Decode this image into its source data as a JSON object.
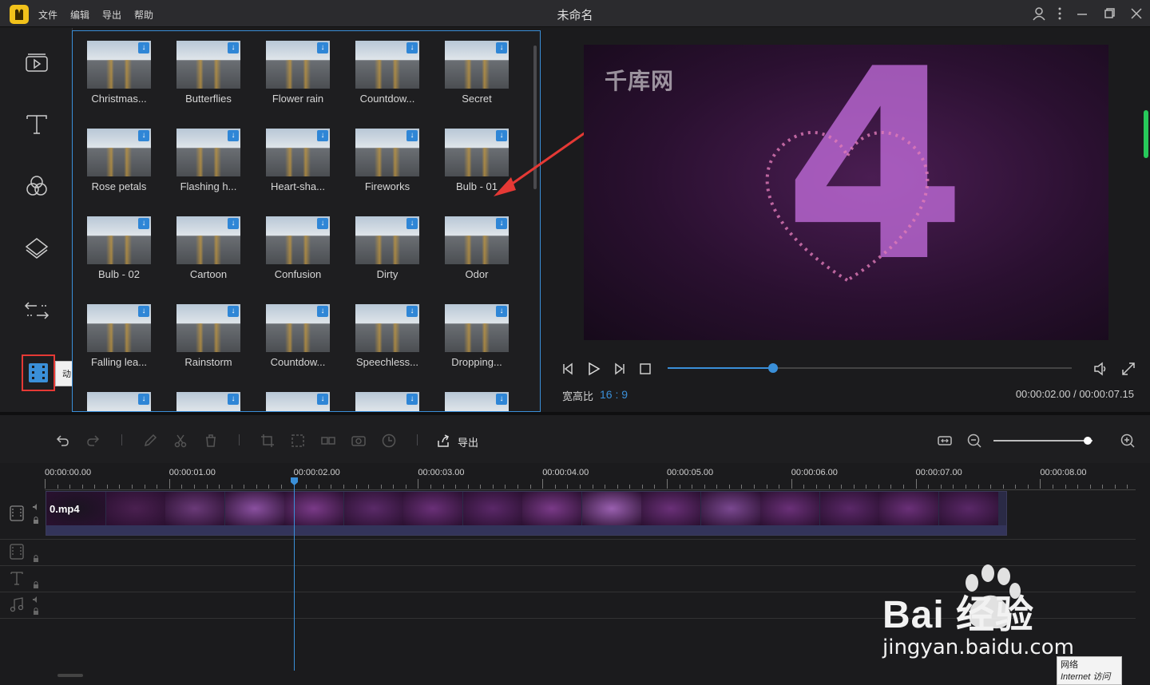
{
  "menu": [
    "文件",
    "编辑",
    "导出",
    "帮助"
  ],
  "window_title": "未命名",
  "sidebar": {
    "items": [
      "media-icon",
      "text-icon",
      "filter-icon",
      "overlay-icon",
      "transition-icon",
      "animation-icon"
    ],
    "tooltip": "动画"
  },
  "effects": [
    {
      "label": "Christmas..."
    },
    {
      "label": "Butterflies"
    },
    {
      "label": "Flower rain"
    },
    {
      "label": "Countdow..."
    },
    {
      "label": "Secret"
    },
    {
      "label": "Rose petals"
    },
    {
      "label": "Flashing h..."
    },
    {
      "label": "Heart-sha..."
    },
    {
      "label": "Fireworks"
    },
    {
      "label": "Bulb - 01"
    },
    {
      "label": "Bulb - 02"
    },
    {
      "label": "Cartoon"
    },
    {
      "label": "Confusion"
    },
    {
      "label": "Dirty"
    },
    {
      "label": "Odor"
    },
    {
      "label": "Falling lea..."
    },
    {
      "label": "Rainstorm"
    },
    {
      "label": "Countdow..."
    },
    {
      "label": "Speechless..."
    },
    {
      "label": "Dropping..."
    }
  ],
  "preview": {
    "watermark": "千库网",
    "aspect_label": "宽高比",
    "aspect_value": "16 : 9",
    "time": "00:00:02.00 / 00:00:07.15",
    "progress": 0.26
  },
  "toolbar": {
    "export_label": "导出",
    "zoom_level": 0.95
  },
  "timeline": {
    "ticks": [
      "00:00:00.00",
      "00:00:01.00",
      "00:00:02.00",
      "00:00:03.00",
      "00:00:04.00",
      "00:00:05.00",
      "00:00:06.00",
      "00:00:07.00",
      "00:00:08.00"
    ],
    "clip_name": "0.mp4"
  },
  "watermark": {
    "site": "Bai 经验",
    "url": "jingyan.baidu.com"
  },
  "network": {
    "line1": "网络",
    "line2": "Internet 访问"
  },
  "colors": {
    "accent": "#3a8fd8",
    "highlight_border": "#e53935",
    "logo": "#f2c21b"
  }
}
